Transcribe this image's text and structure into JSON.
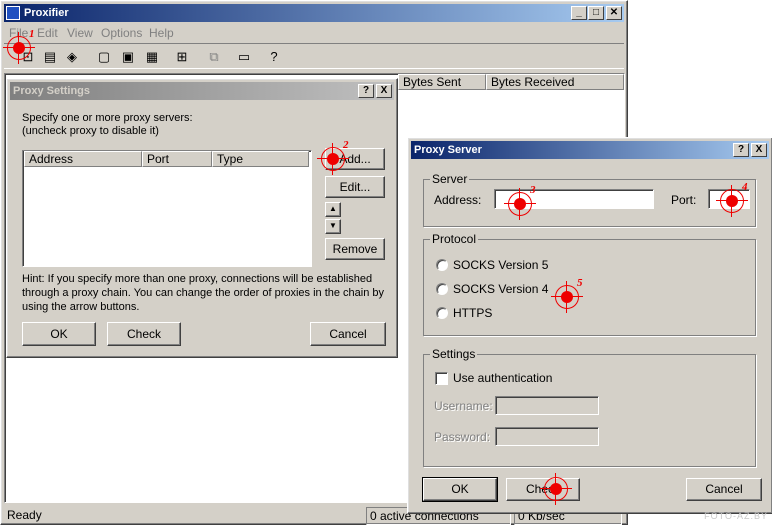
{
  "main_window": {
    "title": "Proxifier",
    "menu": [
      "File",
      "Edit",
      "View",
      "Options",
      "Help"
    ],
    "columns": [
      "Bytes Sent",
      "Bytes Received"
    ],
    "status": {
      "ready": "Ready",
      "connections": "0 active connections",
      "speed": "0 Kb/sec"
    }
  },
  "proxy_settings": {
    "title": "Proxy Settings",
    "help_btn": "?",
    "close_btn": "X",
    "intro_line1": "Specify one or more proxy servers:",
    "intro_line2": "(uncheck proxy to disable it)",
    "columns": {
      "address": "Address",
      "port": "Port",
      "type": "Type"
    },
    "add": "Add...",
    "edit": "Edit...",
    "remove": "Remove",
    "up_arrow": "▲",
    "down_arrow": "▼",
    "hint_line1": "Hint: If you specify more than one proxy, connections will be established",
    "hint_line2": "through a proxy chain. You can change the order of proxies in the chain by",
    "hint_line3": "using the arrow buttons.",
    "ok": "OK",
    "check": "Check",
    "cancel": "Cancel"
  },
  "proxy_server": {
    "title": "Proxy Server",
    "help_btn": "?",
    "close_btn": "X",
    "server_group": "Server",
    "address_label": "Address:",
    "address_value": "",
    "port_label": "Port:",
    "port_value": "",
    "protocol_group": "Protocol",
    "protocols": [
      "SOCKS Version 5",
      "SOCKS Version 4",
      "HTTPS"
    ],
    "settings_group": "Settings",
    "use_auth": "Use authentication",
    "username_label": "Username:",
    "password_label": "Password:",
    "ok": "OK",
    "check": "Check",
    "cancel": "Cancel"
  },
  "markers": [
    "1",
    "2",
    "3",
    "4",
    "5"
  ],
  "watermark": "FOTO-AZ.BY",
  "colors": {
    "marker": "#ee0000",
    "titlebar_active": "#0a246a",
    "face": "#d4d0c8"
  }
}
